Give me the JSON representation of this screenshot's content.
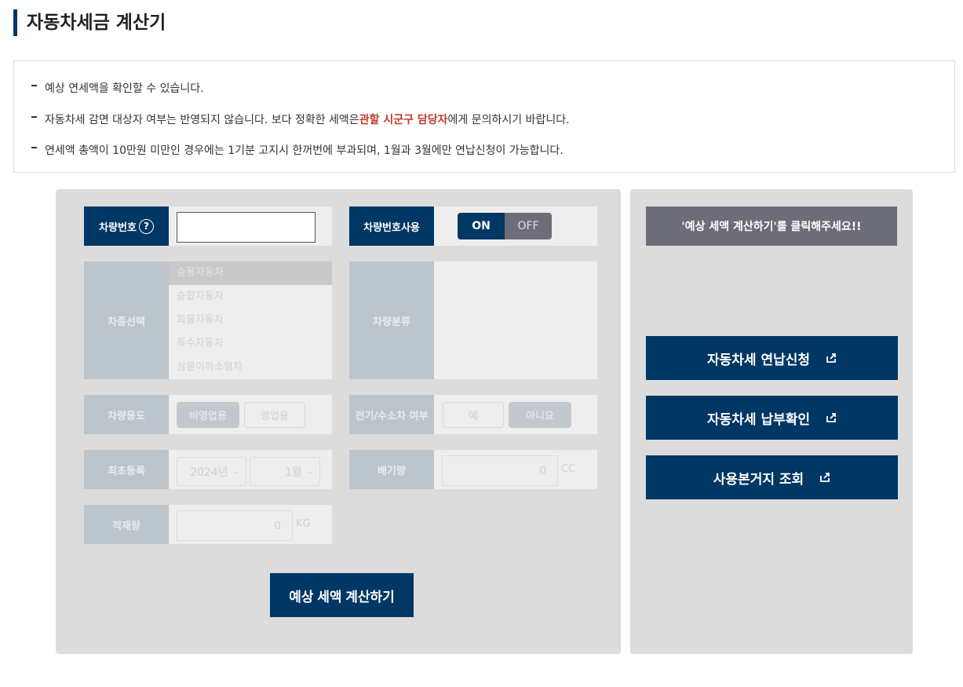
{
  "page": {
    "title": "자동차세금 계산기"
  },
  "notices": [
    {
      "text": "예상 연세액을 확인할 수 있습니다."
    },
    {
      "pre": "자동차세 감면 대상자 여부는 반영되지 않습니다. 보다 정확한 세액은 ",
      "highlight": "관할 시군구 담당자",
      "post": "에게 문의하시기 바랍니다."
    },
    {
      "text": "연세액 총액이 10만원 미만인 경우에는 1기분 고지시 한꺼번에 부과되며, 1월과 3월에만 연납신청이 가능합니다."
    }
  ],
  "form": {
    "plate_label": "차량번호",
    "help_glyph": "?",
    "plate_value": "",
    "plate_use_label": "차량번호사용",
    "toggle_on": "ON",
    "toggle_off": "OFF",
    "vehicle_type_label": "차종선택",
    "vehicle_types": [
      "승용자동차",
      "승합자동차",
      "화물자동차",
      "특수자동차",
      "삼륜이하소형차"
    ],
    "vehicle_class_label": "차량분류",
    "usage_label": "차량용도",
    "usage_options": [
      "비영업용",
      "영업용"
    ],
    "ev_label": "전기/수소차 여부",
    "ev_options": [
      "예",
      "아니요"
    ],
    "first_reg_label": "최초등록",
    "year_value": "2024년",
    "month_value": "1월",
    "displacement_label": "배기량",
    "displacement_value": "0",
    "displacement_unit": "CC",
    "load_label": "적재량",
    "load_value": "0",
    "load_unit": "KG",
    "calc_button": "예상 세액 계산하기"
  },
  "side": {
    "message": "'예상 세액 계산하기'를 클릭해주세요!!",
    "links": [
      "자동차세 연납신청",
      "자동차세 납부확인",
      "사용본거지 조회"
    ]
  },
  "colors": {
    "primary": "#003764",
    "highlight": "#c0392b",
    "panel": "#dcdcdc"
  }
}
